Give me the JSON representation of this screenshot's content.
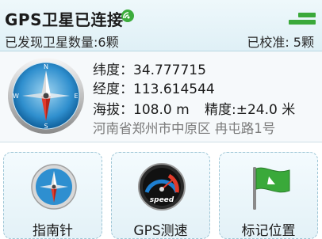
{
  "header": {
    "title": "GPS卫星已连接",
    "status_icon": "gps-connected-icon",
    "signal_icon": "signal-bars-icon",
    "satellites_found": "已发现卫星数量:6颗",
    "satellites_calibrated": "已校准: 5颗"
  },
  "info": {
    "compass_icon": "compass-icon",
    "latitude": "纬度：34.777715",
    "longitude": "经度：113.614544",
    "altitude": "海拔：108.0 m",
    "accuracy": "精度:±24.0 米",
    "address": "河南省郑州市中原区 冉屯路1号"
  },
  "tiles": [
    {
      "label": "指南针",
      "icon": "compass-icon"
    },
    {
      "label": "GPS测速",
      "icon": "speedometer-icon",
      "icon_text": "speed"
    },
    {
      "label": "标记位置",
      "icon": "flag-icon"
    }
  ],
  "colors": {
    "accent": "#2fa52f",
    "header_bg": "#e6f4f9",
    "tile_border": "#9fc6d6",
    "address_text": "#7a7a7a"
  }
}
